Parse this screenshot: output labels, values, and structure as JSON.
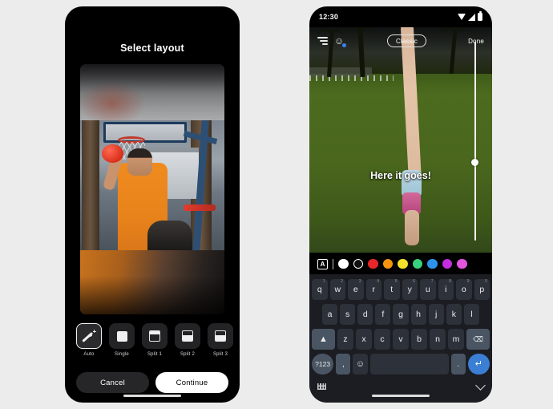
{
  "background_color": "#ececed",
  "left_phone": {
    "title": "Select layout",
    "preview": {
      "description": "photo of a person in an orange tank top holding a red ball at an outdoor basketball court, blurred at top and bottom"
    },
    "layout_options": [
      {
        "label": "Auto",
        "icon": "magic-wand-icon",
        "selected": true
      },
      {
        "label": "Single",
        "icon": "single-frame-icon",
        "selected": false
      },
      {
        "label": "Split 1",
        "icon": "split-1-icon",
        "selected": false
      },
      {
        "label": "Split 2",
        "icon": "split-2-icon",
        "selected": false
      },
      {
        "label": "Split 3",
        "icon": "split-3-icon",
        "selected": false
      }
    ],
    "cancel_label": "Cancel",
    "continue_label": "Continue"
  },
  "right_phone": {
    "status_bar": {
      "time": "12:30",
      "icons": [
        "wifi-icon",
        "signal-icon",
        "battery-icon"
      ]
    },
    "toolbar": {
      "menu_icon": "text-lines-icon",
      "voice_icon": "voice-access-icon",
      "style_label": "Classic",
      "done_label": "Done"
    },
    "video": {
      "caption": "Here it goes!",
      "description": "person doing a handstand on green grass with palm trees in the background"
    },
    "slider": {
      "name": "size-slider",
      "value_position_pct": 59
    },
    "color_bar": {
      "text_style_label": "A",
      "swatches": [
        {
          "name": "white",
          "hex": "#ffffff",
          "ringed": false
        },
        {
          "name": "black",
          "hex": "#101010",
          "ringed": true
        },
        {
          "name": "red",
          "hex": "#e8262a",
          "ringed": false
        },
        {
          "name": "orange",
          "hex": "#f5950f",
          "ringed": false
        },
        {
          "name": "yellow",
          "hex": "#f2e02a",
          "ringed": false
        },
        {
          "name": "green",
          "hex": "#3ad17e",
          "ringed": false
        },
        {
          "name": "blue",
          "hex": "#2e93ec",
          "ringed": false
        },
        {
          "name": "purple",
          "hex": "#c32ee0",
          "ringed": false
        },
        {
          "name": "pink",
          "hex": "#e355dd",
          "ringed": false
        }
      ]
    },
    "keyboard": {
      "row1": [
        {
          "key": "q",
          "num": "1"
        },
        {
          "key": "w",
          "num": "2"
        },
        {
          "key": "e",
          "num": "3"
        },
        {
          "key": "r",
          "num": "4"
        },
        {
          "key": "t",
          "num": "5"
        },
        {
          "key": "y",
          "num": "6"
        },
        {
          "key": "u",
          "num": "7"
        },
        {
          "key": "i",
          "num": "8"
        },
        {
          "key": "o",
          "num": "9"
        },
        {
          "key": "p",
          "num": "0"
        }
      ],
      "row2": [
        "a",
        "s",
        "d",
        "f",
        "g",
        "h",
        "j",
        "k",
        "l"
      ],
      "row3": [
        "z",
        "x",
        "c",
        "v",
        "b",
        "n",
        "m"
      ],
      "shift_icon": "shift-icon",
      "backspace_icon": "backspace-icon",
      "symbols_label": "?123",
      "comma_label": ",",
      "emoji_icon": "emoji-icon",
      "period_label": ".",
      "enter_icon": "return-icon",
      "switcher_icon": "keyboard-switcher-icon",
      "dismiss_icon": "chevron-down-icon"
    }
  }
}
